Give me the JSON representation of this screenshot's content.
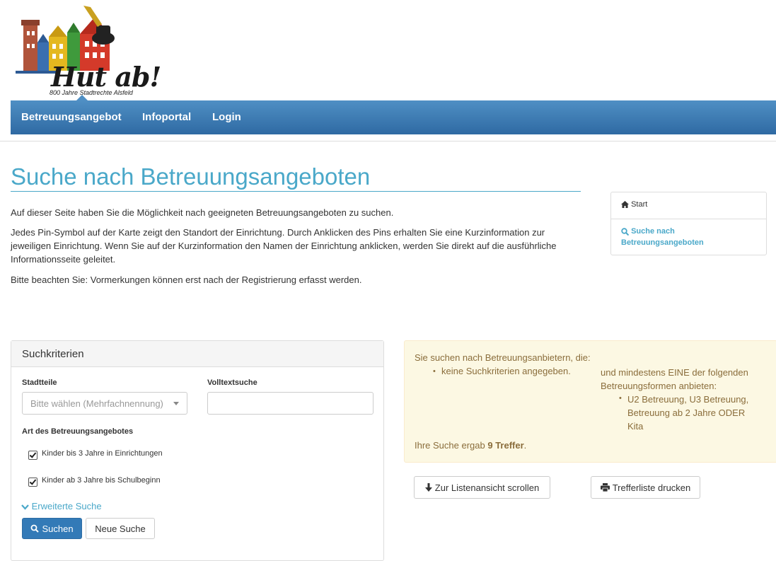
{
  "logo": {
    "title": "Hut ab!",
    "subtitle": "800 Jahre Stadtrechte Alsfeld"
  },
  "nav": {
    "items": [
      "Betreuungsangebot",
      "Infoportal",
      "Login"
    ]
  },
  "page": {
    "title": "Suche nach Betreuungsangeboten",
    "intro1": "Auf dieser Seite haben Sie die Möglichkeit nach geeigneten Betreuungsangeboten zu suchen.",
    "intro2": "Jedes Pin-Symbol auf der Karte zeigt den Standort der Einrichtung. Durch Anklicken des Pins erhalten Sie eine Kurzinformation zur jeweiligen Einrichtung. Wenn Sie auf der Kurzinformation den Namen der Einrichtung anklicken, werden Sie direkt auf die ausführliche Informationsseite geleitet.",
    "intro3": "Bitte beachten Sie: Vormerkungen können erst nach der Registrierung erfasst werden."
  },
  "breadcrumb": {
    "start": "Start",
    "current": "Suche nach Betreuungsangeboten"
  },
  "search_panel": {
    "heading": "Suchkriterien",
    "stadtteile_label": "Stadtteile",
    "stadtteile_placeholder": "Bitte wählen (Mehrfachnennung)",
    "volltext_label": "Volltextsuche",
    "volltext_value": "",
    "art_label": "Art des Betreuungsangebotes",
    "checkbox1": "Kinder bis 3 Jahre in Einrichtungen",
    "checkbox2": "Kinder ab 3 Jahre bis Schulbeginn",
    "extended": "Erweiterte Suche",
    "search_button": "Suchen",
    "new_search_button": "Neue Suche"
  },
  "alert": {
    "line1": "Sie suchen nach Betreuungsanbietern, die:",
    "item1": "keine Suchkriterien angegeben.",
    "line2": "und mindestens EINE der folgenden Betreuungsformen anbieten:",
    "item2": "U2 Betreuung, U3 Betreuung, Betreuung ab 2 Jahre ODER Kita",
    "result_prefix": "Ihre Suche ergab",
    "result_count": "9 Treffer",
    "result_suffix": "."
  },
  "actions": {
    "scroll_button": "Zur Listenansicht scrollen",
    "print_button": "Trefferliste drucken"
  },
  "colors": {
    "accent": "#4aa8c9",
    "nav": "#3d7fb8",
    "primary": "#337ab7",
    "alert_bg": "#fcf8e3"
  }
}
